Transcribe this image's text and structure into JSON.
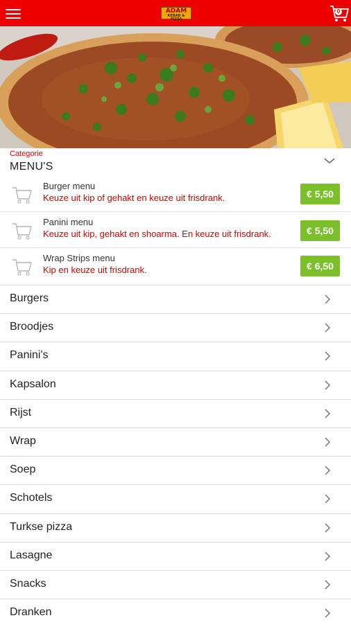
{
  "header": {
    "logo_text": "ADAM",
    "logo_sub": "KEBAB & PIZZA",
    "cart_count": "0"
  },
  "category": {
    "label": "Categorie",
    "title": "MENU'S"
  },
  "menu_items": [
    {
      "name": "Burger menu",
      "desc": "Keuze uit kip of gehakt en keuze uit frisdrank.",
      "price": "€ 5,50"
    },
    {
      "name": "Panini menu",
      "desc": "Keuze uit kip, gehakt en shoarma. En keuze uit frisdrank.",
      "price": "€ 5,50"
    },
    {
      "name": "Wrap Strips menu",
      "desc": "Kip en keuze uit frisdrank.",
      "price": "€ 6,50"
    }
  ],
  "categories": [
    "Burgers",
    "Broodjes",
    "Panini's",
    "Kapsalon",
    "Rijst",
    "Wrap",
    "Soep",
    "Schotels",
    "Turkse pizza",
    "Lasagne",
    "Snacks",
    "Dranken"
  ],
  "colors": {
    "header_red": "#ee0000",
    "price_green": "#7bbf2a",
    "desc_red": "#d40000"
  }
}
